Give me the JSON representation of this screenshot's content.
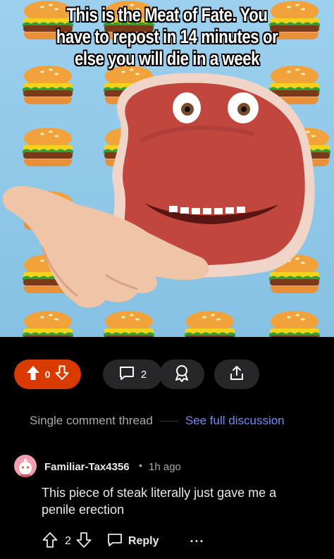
{
  "meme": {
    "caption_lines": [
      "This is the Meat of Fate. You",
      "have to repost in 14 minutes or",
      "else you will die in a week"
    ]
  },
  "post_actions": {
    "vote_count": "0",
    "comment_count": "2",
    "accent_color": "#d93a00"
  },
  "thread_nav": {
    "single_label": "Single comment thread",
    "full_label": "See full discussion"
  },
  "comment": {
    "author": "Familiar-Tax4356",
    "separator": "•",
    "time": "1h ago",
    "body": "This piece of steak literally just gave me a penile erection",
    "vote_count": "2",
    "reply_label": "Reply",
    "more_label": "···"
  },
  "icons": [
    "upvote-icon",
    "downvote-icon",
    "comment-icon",
    "award-icon",
    "share-icon",
    "reply-icon",
    "more-icon"
  ]
}
